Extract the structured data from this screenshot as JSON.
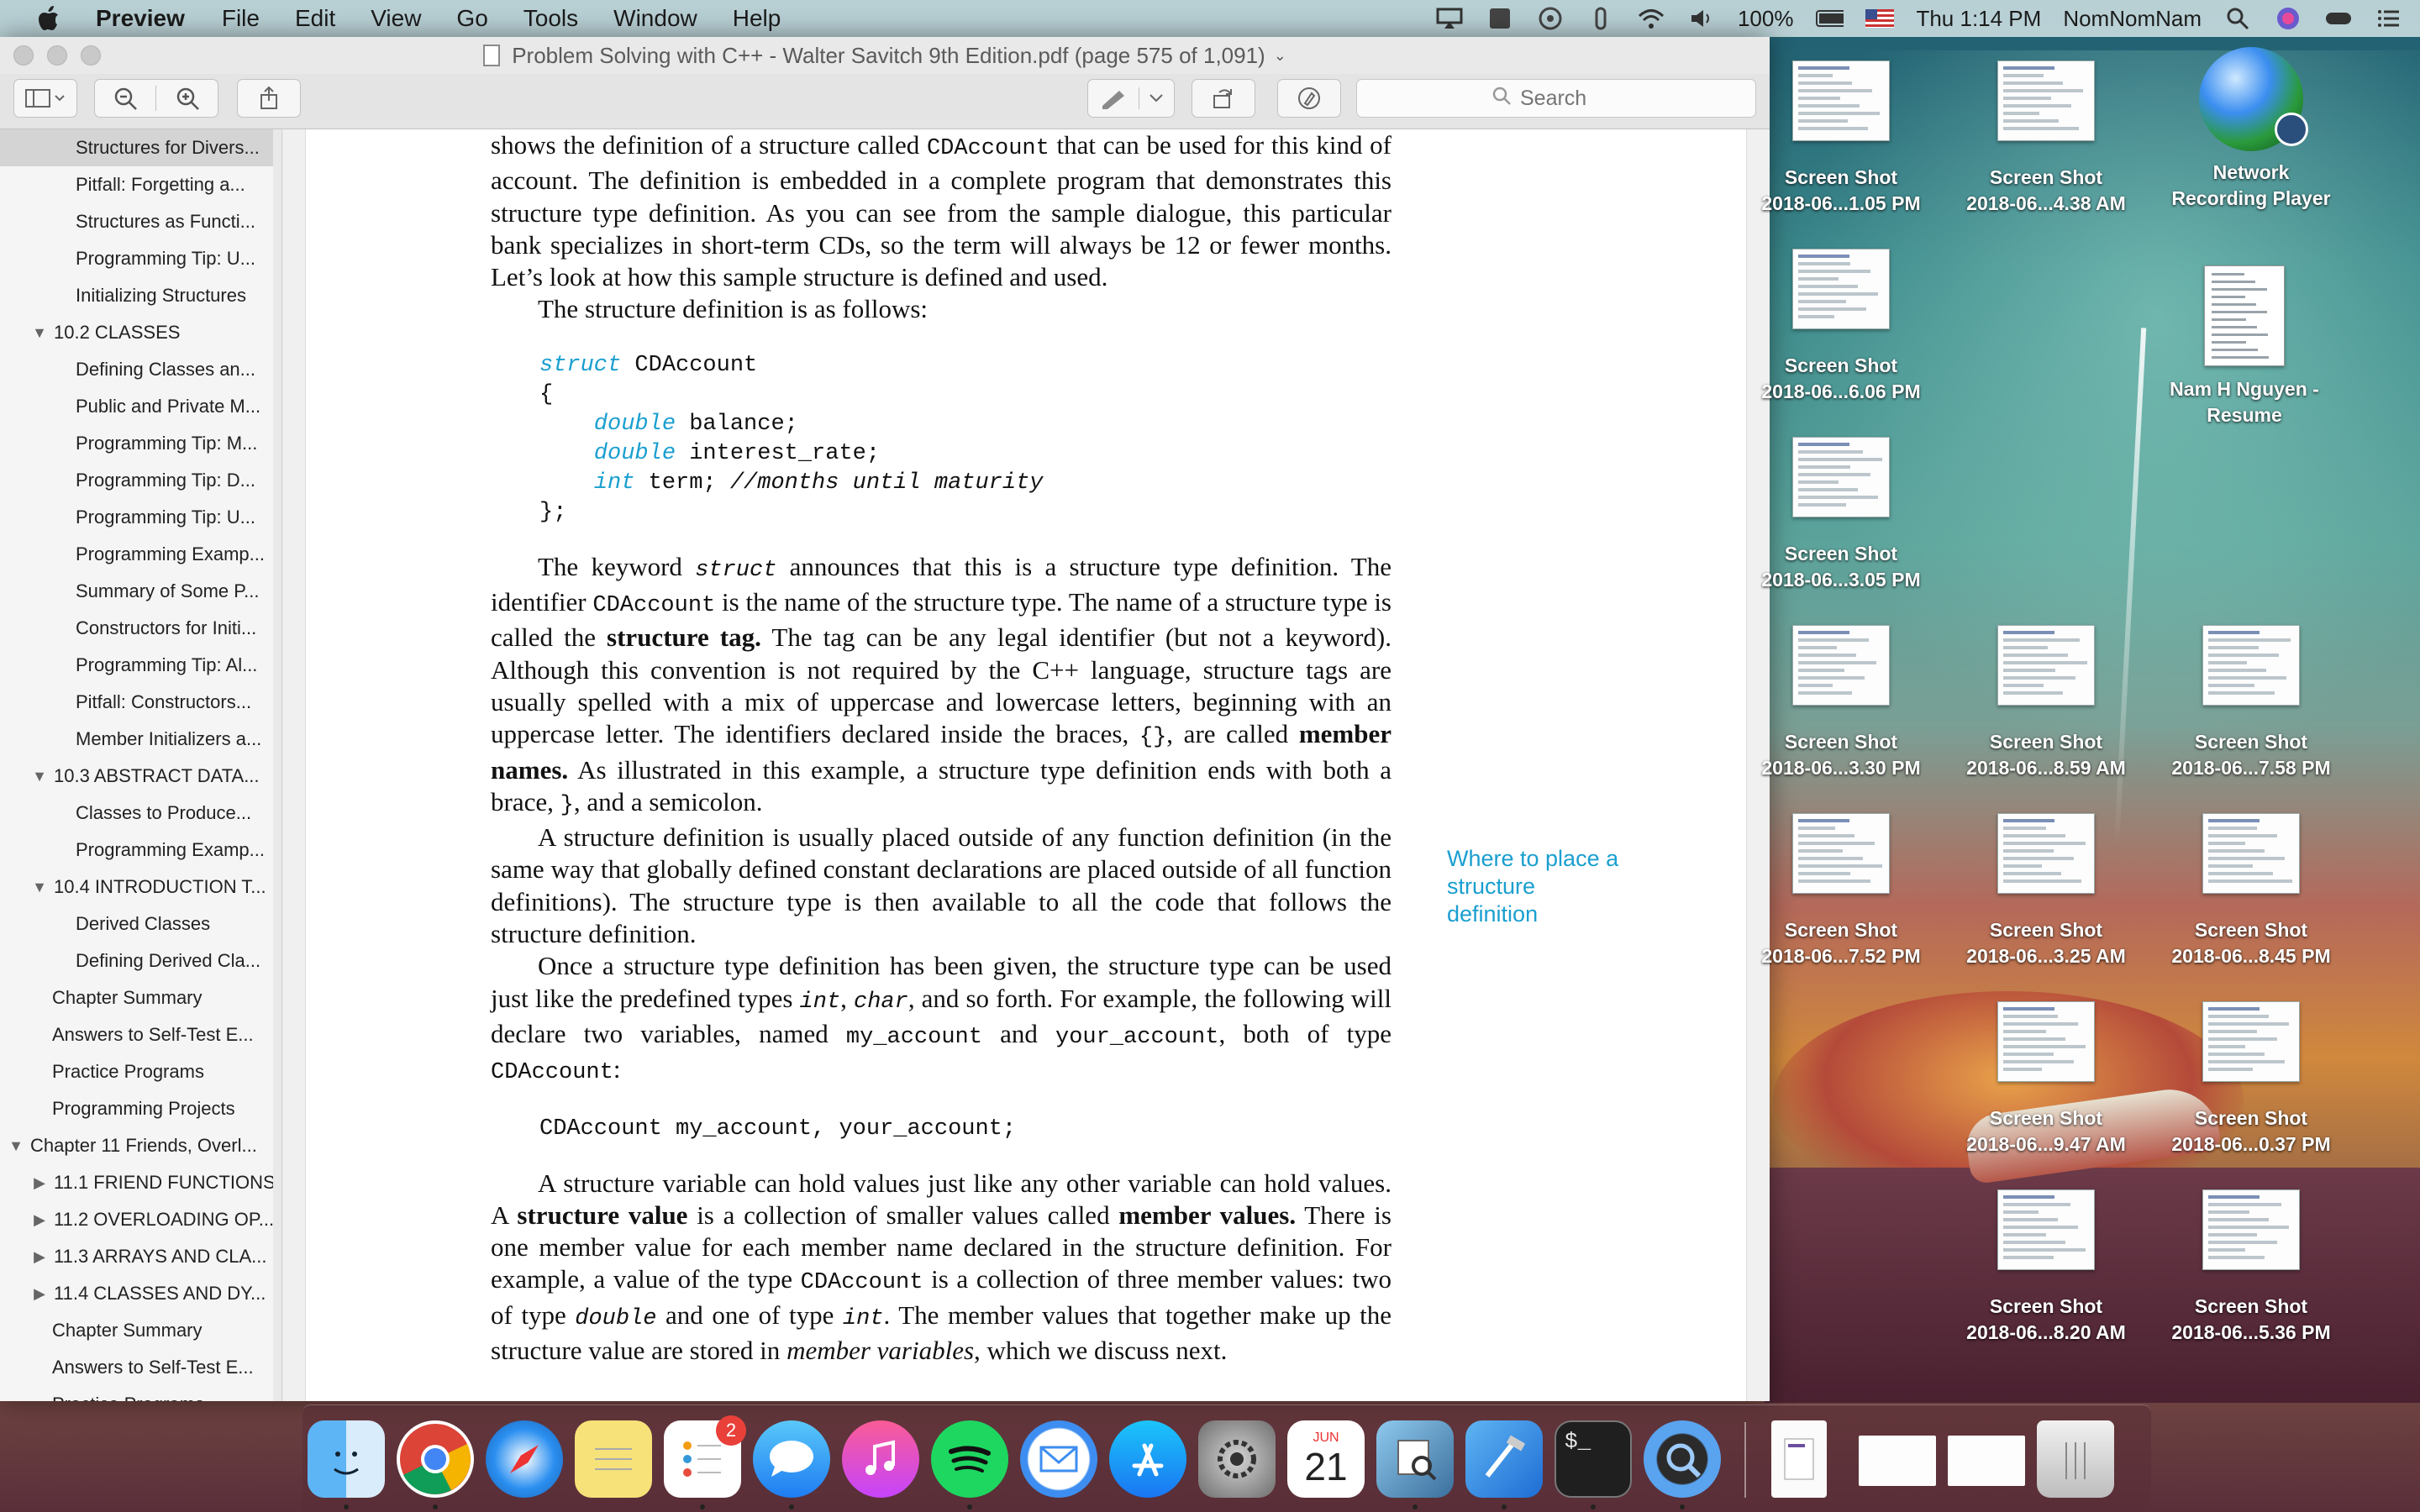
{
  "menubar": {
    "app_name": "Preview",
    "menus": [
      "File",
      "Edit",
      "View",
      "Go",
      "Tools",
      "Window",
      "Help"
    ],
    "battery": "100%",
    "clock": "Thu 1:14 PM",
    "user": "NomNomNam"
  },
  "window": {
    "title": "Problem Solving with C++ - Walter Savitch 9th Edition.pdf (page 575 of 1,091)",
    "search_placeholder": "Search"
  },
  "sidebar": {
    "items": [
      {
        "label": "Structures for Divers...",
        "level": 2,
        "selected": true
      },
      {
        "label": "Pitfall: Forgetting a...",
        "level": 2
      },
      {
        "label": "Structures as Functi...",
        "level": 2
      },
      {
        "label": "Programming Tip: U...",
        "level": 2
      },
      {
        "label": "Initializing Structures",
        "level": 2
      },
      {
        "label": "10.2 CLASSES",
        "level": 1,
        "expanded": true
      },
      {
        "label": "Defining Classes an...",
        "level": 2
      },
      {
        "label": "Public and Private M...",
        "level": 2
      },
      {
        "label": "Programming Tip: M...",
        "level": 2
      },
      {
        "label": "Programming Tip: D...",
        "level": 2
      },
      {
        "label": "Programming Tip: U...",
        "level": 2
      },
      {
        "label": "Programming Examp...",
        "level": 2
      },
      {
        "label": "Summary of Some P...",
        "level": 2
      },
      {
        "label": "Constructors for Initi...",
        "level": 2
      },
      {
        "label": "Programming Tip: Al...",
        "level": 2
      },
      {
        "label": "Pitfall: Constructors...",
        "level": 2
      },
      {
        "label": "Member Initializers a...",
        "level": 2
      },
      {
        "label": "10.3 ABSTRACT DATA...",
        "level": 1,
        "expanded": true
      },
      {
        "label": "Classes to Produce...",
        "level": 2
      },
      {
        "label": "Programming Examp...",
        "level": 2
      },
      {
        "label": "10.4 INTRODUCTION T...",
        "level": 1,
        "expanded": true
      },
      {
        "label": "Derived Classes",
        "level": 2
      },
      {
        "label": "Defining Derived Cla...",
        "level": 2
      },
      {
        "label": "Chapter Summary",
        "level": 1
      },
      {
        "label": "Answers to Self-Test E...",
        "level": 1
      },
      {
        "label": "Practice Programs",
        "level": 1
      },
      {
        "label": "Programming Projects",
        "level": 1
      },
      {
        "label": "Chapter 11 Friends, Overl...",
        "level": 0,
        "expanded": true
      },
      {
        "label": "11.1 FRIEND FUNCTIONS",
        "level": 1,
        "expanded": false
      },
      {
        "label": "11.2 OVERLOADING OP...",
        "level": 1,
        "expanded": false
      },
      {
        "label": "11.3 ARRAYS AND CLA...",
        "level": 1,
        "expanded": false
      },
      {
        "label": "11.4 CLASSES AND DY...",
        "level": 1,
        "expanded": false
      },
      {
        "label": "Chapter Summary",
        "level": 1
      },
      {
        "label": "Answers to Self-Test E...",
        "level": 1
      },
      {
        "label": "Practice Programs",
        "level": 1
      }
    ]
  },
  "page": {
    "p1": {
      "a": "shows the definition of a structure called ",
      "code1": "CDAccount",
      "b": " that can be used for this kind of account. The definition is embedded in a complete program that demonstrates this structure type definition. As you can see from the sample dialogue, this particular bank specializes in short-term CDs, so the term will always be 12 or fewer months. Let’s look at how this sample structure is defined and used."
    },
    "p2": "The structure definition is as follows:",
    "code_struct": {
      "kw_struct": "struct",
      "name": " CDAccount",
      "open": "{",
      "kw_double1": "double",
      "m1": " balance;",
      "kw_double2": "double",
      "m2": " interest_rate;",
      "kw_int": "int",
      "m3": " term; ",
      "comment": "//months until maturity",
      "close": "};"
    },
    "p3": {
      "a": "The keyword ",
      "kw": "struct",
      "b": " announces that this is a structure type definition. The identifier ",
      "code1": "CDAccount",
      "c": " is the name of the structure type. The name of a structure type is called the ",
      "bold1": "structure tag.",
      "d": " The tag can be any legal identifier (but not a keyword). Although this convention is not required by the C++ language, structure tags are usually spelled with a mix of uppercase and lowercase letters, beginning with an uppercase letter. The identifiers declared inside the braces, ",
      "code2": "{}",
      "e": ", are called ",
      "bold2": "member names.",
      "f": " As illustrated in this example, a structure type definition ends with both a brace, ",
      "code3": "}",
      "g": ", and a semicolon."
    },
    "p4": "A structure definition is usually placed outside of any function definition (in the same way that globally defined constant declarations are placed outside of all function definitions). The structure type is then available to all the code that follows the structure definition.",
    "p5": {
      "a": "Once a structure type definition has been given, the structure type can be used just like the predefined types ",
      "kw1": "int",
      "b": ", ",
      "kw2": "char",
      "c": ", and so forth. For example, the following will declare two variables, named ",
      "code1": "my_account",
      "d": " and ",
      "code2": "your_account",
      "e": ", both of type ",
      "code3": "CDAccount",
      "f": ":"
    },
    "code_decl": "CDAccount my_account, your_account;",
    "p6": {
      "a": "A structure variable can hold values just like any other variable can hold values. A ",
      "bold1": "structure value",
      "b": " is a collection of smaller values called ",
      "bold2": "member values.",
      "c": " There is one member value for each member name declared in the structure definition. For example, a value of the type ",
      "code1": "CDAccount",
      "d": " is a collection of three member values: two of type ",
      "kw1": "double",
      "e": " and one of type ",
      "kw2": "int",
      "f": ". The member values that together make up the structure value are stored in ",
      "ital": "member variables",
      "g": ", which we discuss next."
    },
    "margin_note": "Where to place a structure definition"
  },
  "desktop": {
    "items": [
      {
        "line1": "Screen Shot",
        "line2": "2018-06...1.05 PM"
      },
      {
        "line1": "Screen Shot",
        "line2": "2018-06...4.38 AM"
      },
      {
        "line1": "Network",
        "line2": "Recording Player"
      },
      {
        "line1": "Screen Shot",
        "line2": "2018-06...6.06 PM"
      },
      {
        "line1": "Nam H Nguyen -",
        "line2": "Resume"
      },
      {
        "line1": "Screen Shot",
        "line2": "2018-06...3.05 PM"
      },
      {
        "line1": "Screen Shot",
        "line2": "2018-06...3.30 PM"
      },
      {
        "line1": "Screen Shot",
        "line2": "2018-06...8.59 AM"
      },
      {
        "line1": "Screen Shot",
        "line2": "2018-06...7.58 PM"
      },
      {
        "line1": "Screen Shot",
        "line2": "2018-06...7.52 PM"
      },
      {
        "line1": "Screen Shot",
        "line2": "2018-06...3.25 AM"
      },
      {
        "line1": "Screen Shot",
        "line2": "2018-06...8.45 PM"
      },
      {
        "line1": "Screen Shot",
        "line2": "2018-06...9.47 AM"
      },
      {
        "line1": "Screen Shot",
        "line2": "2018-06...0.37 PM"
      },
      {
        "line1": "Screen Shot",
        "line2": "2018-06...8.20 AM"
      },
      {
        "line1": "Screen Shot",
        "line2": "2018-06...5.36 PM"
      }
    ]
  },
  "dock": {
    "reminders_badge": "2",
    "calendar_month": "JUN",
    "calendar_day": "21",
    "terminal_prompt": "$_"
  }
}
